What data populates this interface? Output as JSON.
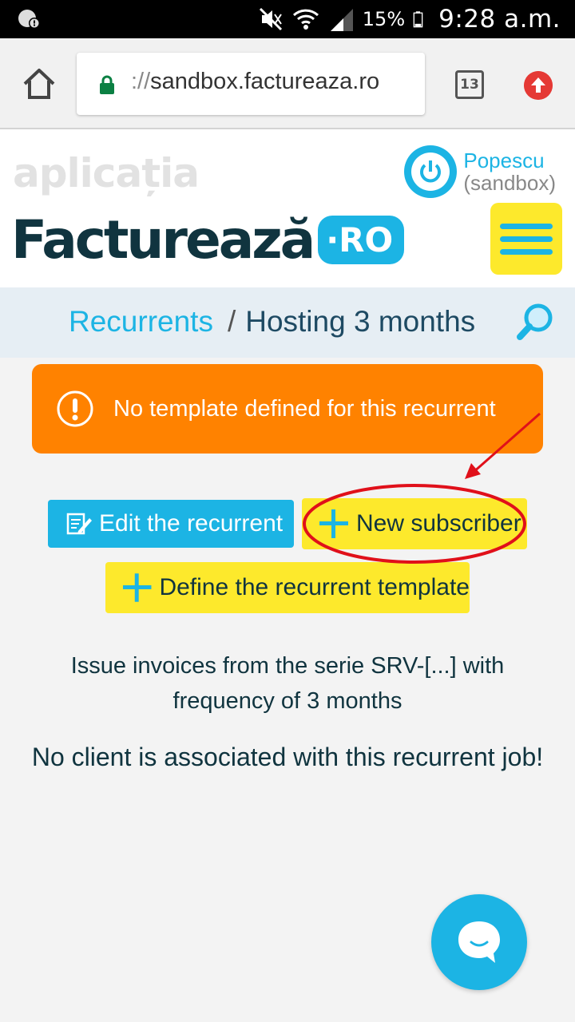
{
  "status_bar": {
    "battery_percent": "15%",
    "time": "9:28 a.m."
  },
  "browser": {
    "url_scheme": "://",
    "url_host": "sandbox.factureaza.ro",
    "tab_count": "13"
  },
  "site": {
    "tagline": "aplicația",
    "logo_text": "Facturează",
    "logo_suffix": "·RO",
    "user_name": "Popescu",
    "user_context": "(sandbox)"
  },
  "breadcrumb": {
    "parent": "Recurrents",
    "separator": "/",
    "current": "Hosting 3 months"
  },
  "alert": {
    "text": "No template defined for this recurrent",
    "color": "#ff8200"
  },
  "actions": {
    "edit_label": "Edit the recurrent",
    "new_subscriber_label": "New subscriber",
    "define_template_label": "Define the recurrent template"
  },
  "info": {
    "line1": "Issue invoices from the serie SRV-[...] with",
    "line2": "frequency of 3 months",
    "no_client": "No client is associated with this recurrent job!"
  },
  "colors": {
    "accent": "#1cb4e4",
    "highlight": "#fde92c",
    "dark": "#10343f"
  }
}
